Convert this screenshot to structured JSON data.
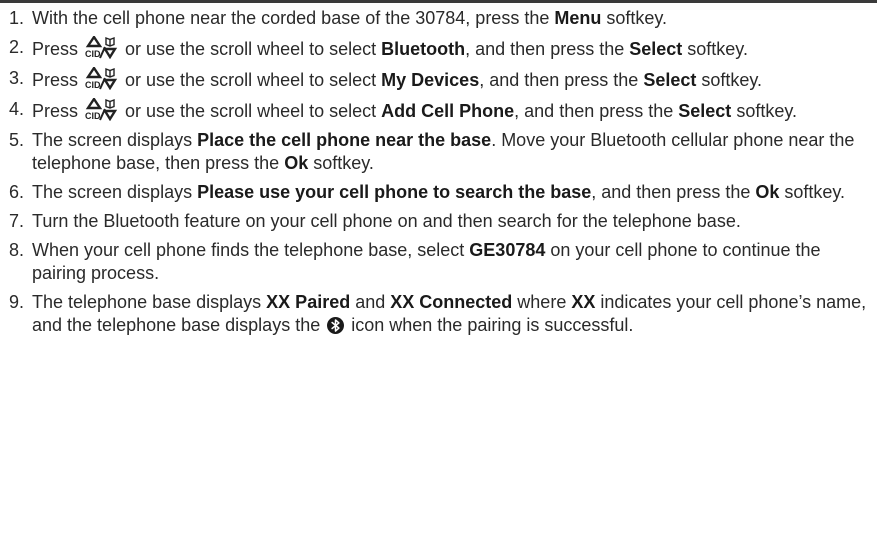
{
  "steps": [
    {
      "num": "1.",
      "t1": "With the cell phone near the corded base of the 30784, press the ",
      "b1": "Menu",
      "t2": " softkey."
    },
    {
      "num": "2.",
      "pre": "Press ",
      "t1": " or use the scroll wheel to select ",
      "b1": "Bluetooth",
      "t2": ", and then press the ",
      "b2": "Select",
      "t3": " softkey."
    },
    {
      "num": "3.",
      "pre": "Press ",
      "t1": " or use the scroll wheel to select ",
      "b1": "My Devices",
      "t2": ", and then press the ",
      "b2": "Select",
      "t3": " softkey."
    },
    {
      "num": "4.",
      "pre": "Press ",
      "t1": " or use the scroll wheel to select ",
      "b1": "Add Cell Phone",
      "t2": ", and then press the ",
      "b2": "Select",
      "t3": " softkey."
    },
    {
      "num": "5.",
      "t1": "The screen displays ",
      "b1": "Place the cell phone near the base",
      "t2": ". Move your Bluetooth cellular phone near the telephone base, then press the ",
      "b2": "Ok",
      "t3": " softkey."
    },
    {
      "num": "6.",
      "t1": "The screen displays ",
      "b1": "Please use your cell phone to search the base",
      "t2": ", and then press the ",
      "b2": "Ok",
      "t3": " softkey."
    },
    {
      "num": "7.",
      "t1": "Turn the Bluetooth feature on your cell phone on and then search for the telephone base."
    },
    {
      "num": "8.",
      "t1": "When your cell phone finds the telephone base, select ",
      "b1": "GE30784",
      "t2": " on your cell phone to continue the pairing process."
    },
    {
      "num": "9.",
      "t1": "The telephone base displays ",
      "b1": "XX Paired",
      "t2": " and ",
      "b2": "XX Connected",
      "t3": " where ",
      "b3": "XX",
      "t4": " indicates your cell phone’s name, and the telephone base displays the ",
      "t5": " icon when the pairing is successful."
    }
  ],
  "nav_icon_text": "CID",
  "icons": {
    "nav_key": "cid-up-down-book-icon",
    "bluetooth": "bluetooth-icon"
  }
}
